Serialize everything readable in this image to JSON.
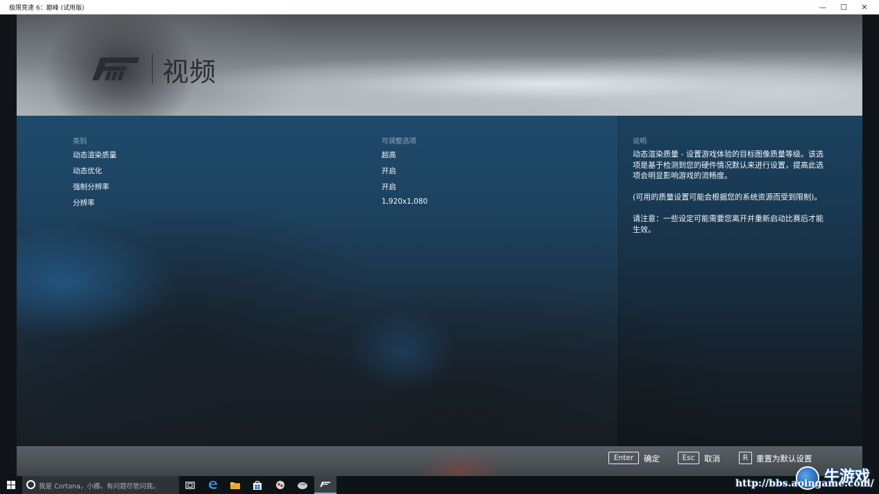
{
  "window": {
    "title": "极限竞速 6：巅峰 (试用版)",
    "minimize": "—",
    "maximize": "☐",
    "close": "✕"
  },
  "header": {
    "title": "视频",
    "logo_icon": "forza-logo-icon"
  },
  "settings": {
    "category_header": "类别",
    "options_header": "可调整选项",
    "description_header": "说明",
    "rows": [
      {
        "category": "动态渲染质量",
        "value": "超高"
      },
      {
        "category": "动态优化",
        "value": "开启"
      },
      {
        "category": "强制分辨率",
        "value": "开启"
      },
      {
        "category": "分辨率",
        "value": "1,920x1,080"
      }
    ],
    "description": [
      "动态渲染质量 - 设置游戏体验的目标图像质量等级。该选项是基于检测到您的硬件情况默认来进行设置，提高此选项会明显影响游戏的流畅度。",
      "(可用的质量设置可能会根据您的系统资源而受到限制)。",
      "请注意：一些设定可能需要您离开并重新启动比赛后才能生效。"
    ]
  },
  "footer": {
    "hints": [
      {
        "key": "Enter",
        "label": "确定"
      },
      {
        "key": "Esc",
        "label": "取消"
      },
      {
        "key": "R",
        "label": "重置为默认设置"
      }
    ]
  },
  "taskbar": {
    "cortana_placeholder": "我是 Cortana，小娜。有问题尽管问我。",
    "icons": [
      "windows-start-icon",
      "task-view-icon",
      "edge-browser-icon",
      "file-explorer-icon",
      "store-icon",
      "game-app-icon",
      "bird-app-icon",
      "forza-app-icon"
    ]
  },
  "watermark": {
    "url": "http://bbs.aoingame.com/",
    "brand": "牛游戏"
  },
  "colors": {
    "accent_blue": "#1e4a6b",
    "text_primary": "#f2f6fa",
    "text_header": "#8fa8bd",
    "title_dark": "#2a2d31"
  }
}
